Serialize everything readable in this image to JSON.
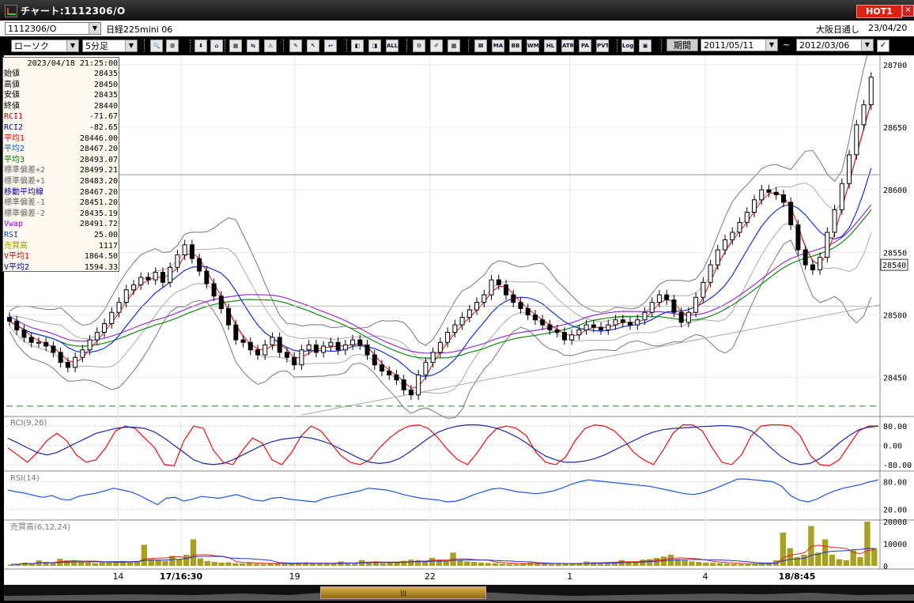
{
  "window": {
    "title": "チャート:1112306/O",
    "hot_label": "HOT1",
    "close_glyph": "×"
  },
  "toolbar": {
    "symbol_code": "1112306/O",
    "symbol_name": "日経225mini 06",
    "session": "大阪日通し",
    "date_stamp": "23/04/20",
    "chart_type": "ローソク",
    "timeframe": "5分足",
    "period_button": "期間",
    "date_from": "2011/05/11",
    "tilde": "~",
    "date_to": "2012/03/06",
    "tool_buttons": [
      "🔍",
      "⊞",
      "⬇",
      "⌂",
      "▦",
      "⇆",
      "⚠",
      "✎",
      "↖",
      "↩",
      "◧",
      "◨",
      "ALL",
      "⚙",
      "✐",
      "▩",
      "Ⅲ",
      "MA",
      "BB",
      "WMA",
      "HL",
      "ATR",
      "PA",
      "PVT",
      "Log",
      "▣"
    ]
  },
  "infobox": {
    "datetime": "2023/04/18  21:25:00",
    "rows": [
      {
        "label": "始値",
        "value": "28435",
        "color": "#000000"
      },
      {
        "label": "高値",
        "value": "28450",
        "color": "#000000"
      },
      {
        "label": "安値",
        "value": "28435",
        "color": "#000000"
      },
      {
        "label": "終値",
        "value": "28440",
        "color": "#000000"
      },
      {
        "label": "RCI1",
        "value": "-71.67",
        "color": "#cc0000"
      },
      {
        "label": "RCI2",
        "value": "-82.65",
        "color": "#000099"
      },
      {
        "label": "平均1",
        "value": "28446.00",
        "color": "#dd0000"
      },
      {
        "label": "平均2",
        "value": "28467.20",
        "color": "#0055dd"
      },
      {
        "label": "平均3",
        "value": "28493.07",
        "color": "#007700"
      },
      {
        "label": "標準偏差+2",
        "value": "28499.21",
        "color": "#666666"
      },
      {
        "label": "標準偏差+1",
        "value": "28483.20",
        "color": "#666666"
      },
      {
        "label": "移動平均線",
        "value": "28467.20",
        "color": "#0000aa"
      },
      {
        "label": "標準偏差-1",
        "value": "28451.20",
        "color": "#666666"
      },
      {
        "label": "標準偏差-2",
        "value": "28435.19",
        "color": "#666666"
      },
      {
        "label": "Vwap",
        "value": "28491.72",
        "color": "#9900cc"
      },
      {
        "label": "RSI",
        "value": "25.00",
        "color": "#0044cc"
      },
      {
        "label": "売買高",
        "value": "1117",
        "color": "#999900"
      },
      {
        "label": "V平均1",
        "value": "1864.50",
        "color": "#cc0000"
      },
      {
        "label": "V平均2",
        "value": "1594.33",
        "color": "#0000aa"
      }
    ]
  },
  "chart_data": [
    {
      "type": "candlestick",
      "panel": "price",
      "ylim": [
        28420,
        28705
      ],
      "y_ticks": [
        "28700",
        "28650",
        "28600",
        "28550",
        "28500",
        "28450"
      ],
      "last_price_label": "28540",
      "x_ticks": [
        "14",
        "17/16:30",
        "19",
        "22",
        "1",
        "4",
        "18/8:45"
      ],
      "close": [
        28495,
        28488,
        28482,
        28478,
        28478,
        28475,
        28470,
        28462,
        28458,
        28466,
        28472,
        28480,
        28486,
        28493,
        28502,
        28510,
        28520,
        28524,
        28530,
        28528,
        28534,
        28526,
        28538,
        28548,
        28556,
        28545,
        28535,
        28525,
        28515,
        28505,
        28492,
        28480,
        28478,
        28472,
        28468,
        28476,
        28482,
        28470,
        28466,
        28460,
        28472,
        28476,
        28470,
        28475,
        28478,
        28472,
        28476,
        28480,
        28476,
        28468,
        28460,
        28455,
        28452,
        28448,
        28440,
        28436,
        28452,
        28462,
        28470,
        28478,
        28486,
        28492,
        28498,
        28504,
        28510,
        28516,
        28528,
        28524,
        28516,
        28510,
        28505,
        28500,
        28496,
        28492,
        28488,
        28486,
        28480,
        28484,
        28488,
        28492,
        28490,
        28488,
        28492,
        28496,
        28494,
        28492,
        28496,
        28502,
        28510,
        28516,
        28512,
        28502,
        28494,
        28502,
        28514,
        28526,
        28540,
        28552,
        28560,
        28566,
        28574,
        28582,
        28592,
        28600,
        28598,
        28596,
        28590,
        28572,
        28552,
        28540,
        28536,
        28546,
        28566,
        28584,
        28605,
        28628,
        28652,
        28668,
        28690
      ]
    },
    {
      "type": "line",
      "panel": "RCI",
      "title": "RCI(9,26)",
      "ylim": [
        -100,
        100
      ],
      "y_ticks": [
        "80.00",
        "0.00",
        "-80.00"
      ],
      "series": [
        {
          "name": "RCI1",
          "values": [
            -10,
            -40,
            -70,
            -30,
            20,
            50,
            20,
            -40,
            -70,
            -60,
            -10,
            60,
            80,
            70,
            30,
            -10,
            -80,
            -85,
            20,
            80,
            70,
            -20,
            -70,
            -80,
            -20,
            30,
            10,
            -60,
            -80,
            -30,
            40,
            80,
            60,
            10,
            -40,
            -70,
            -80,
            -60,
            -10,
            30,
            60,
            80,
            85,
            70,
            30,
            -20,
            -60,
            -80,
            -30,
            30,
            70,
            80,
            70,
            40,
            -30,
            -70,
            -80,
            -50,
            20,
            70,
            85,
            80,
            60,
            20,
            -30,
            -60,
            -80,
            -20,
            50,
            85,
            85,
            60,
            -10,
            -70,
            -80,
            -40,
            40,
            80,
            85,
            85,
            80,
            40,
            -40,
            -80,
            -85,
            -60,
            0,
            60,
            80,
            80
          ]
        },
        {
          "name": "RCI2",
          "values": [
            30,
            10,
            -10,
            -30,
            -40,
            -30,
            -10,
            10,
            30,
            50,
            60,
            70,
            75,
            75,
            70,
            55,
            30,
            0,
            -30,
            -60,
            -75,
            -80,
            -75,
            -60,
            -40,
            -20,
            0,
            15,
            25,
            30,
            35,
            30,
            20,
            5,
            -15,
            -35,
            -55,
            -70,
            -75,
            -70,
            -55,
            -30,
            0,
            30,
            55,
            70,
            80,
            85,
            85,
            80,
            70,
            55,
            35,
            10,
            -20,
            -45,
            -60,
            -70,
            -70,
            -65,
            -55,
            -40,
            -20,
            0,
            20,
            40,
            55,
            65,
            70,
            72,
            75,
            78,
            80,
            82,
            80,
            75,
            60,
            30,
            -10,
            -45,
            -70,
            -80,
            -75,
            -55,
            -25,
            10,
            40,
            65,
            75,
            80
          ]
        }
      ]
    },
    {
      "type": "line",
      "panel": "RSI",
      "title": "RSI(14)",
      "ylim": [
        0,
        100
      ],
      "y_ticks": [
        "80.00",
        "20.00"
      ],
      "series": [
        {
          "name": "RSI",
          "values": [
            62,
            58,
            55,
            50,
            46,
            50,
            42,
            40,
            48,
            52,
            55,
            60,
            66,
            62,
            58,
            50,
            40,
            30,
            44,
            46,
            38,
            42,
            48,
            46,
            44,
            48,
            52,
            46,
            40,
            38,
            44,
            46,
            42,
            40,
            38,
            36,
            44,
            48,
            52,
            56,
            60,
            66,
            64,
            62,
            58,
            52,
            48,
            44,
            42,
            40,
            36,
            38,
            44,
            52,
            58,
            64,
            66,
            62,
            58,
            56,
            54,
            56,
            60,
            66,
            74,
            80,
            84,
            82,
            80,
            78,
            76,
            74,
            72,
            70,
            66,
            62,
            58,
            54,
            52,
            56,
            62,
            70,
            78,
            86,
            86,
            84,
            82,
            80,
            70,
            50,
            40,
            36,
            42,
            52,
            60,
            66,
            70,
            74,
            80,
            84
          ]
        }
      ]
    },
    {
      "type": "bar",
      "panel": "volume",
      "title": "売買高(6,12,24)",
      "ylim": [
        0,
        20000
      ],
      "y_ticks": [
        "20000",
        "10000",
        "0"
      ],
      "values": [
        600,
        900,
        1500,
        1200,
        2500,
        1800,
        1100,
        3200,
        2500,
        2600,
        1900,
        1500,
        1200,
        1600,
        1800,
        1500,
        2200,
        1800,
        2000,
        9500,
        3000,
        2800,
        2200,
        4500,
        3000,
        5000,
        12000,
        3400,
        2200,
        1800,
        1500,
        1600,
        1200,
        1100,
        1500,
        1000,
        800,
        1100,
        1200,
        1000,
        900,
        1500,
        1600,
        1100,
        1200,
        1000,
        900,
        2000,
        1500,
        1400,
        2600,
        1800,
        1600,
        1200,
        1500,
        1800,
        2300,
        2800,
        2600,
        2000,
        3600,
        2500,
        2000,
        6000,
        2700,
        2000,
        1800,
        1500,
        1300,
        1200,
        1000,
        900,
        800,
        1100,
        1500,
        1200,
        1000,
        800,
        900,
        1000,
        1100,
        1300,
        2000,
        1600,
        1500,
        1400,
        1800,
        2600,
        2000,
        1900,
        2800,
        3000,
        3500,
        4200,
        5000,
        3000,
        2500,
        2000,
        1800,
        1500,
        1300,
        1200,
        1000,
        900,
        800,
        700,
        900,
        1200,
        1500,
        2500,
        15000,
        8000,
        4000,
        5000,
        18000,
        6000,
        12000,
        5000,
        3000,
        2500,
        7000,
        4000,
        20000,
        8000
      ]
    }
  ]
}
